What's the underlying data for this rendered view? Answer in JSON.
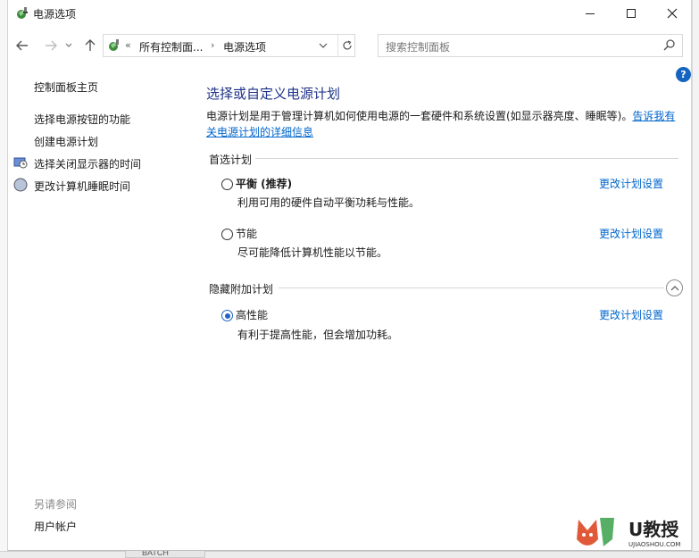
{
  "window": {
    "title": "电源选项"
  },
  "address": {
    "root": "所有控制面...",
    "current": "电源选项",
    "prefix": "«",
    "arrow": "›"
  },
  "search": {
    "placeholder": "搜索控制面板"
  },
  "help": {
    "label": "?"
  },
  "sidebar": {
    "home": "控制面板主页",
    "items": [
      {
        "label": "选择电源按钮的功能"
      },
      {
        "label": "创建电源计划"
      },
      {
        "label": "选择关闭显示器的时间"
      },
      {
        "label": "更改计算机睡眠时间"
      }
    ],
    "see_also_title": "另请参阅",
    "see_also_items": [
      {
        "label": "用户帐户"
      }
    ]
  },
  "main": {
    "title": "选择或自定义电源计划",
    "description_line1": "电源计划是用于管理计算机如何使用电源的一套硬件和系统设置(如显示器亮度、睡眠等)。",
    "description_link_part1": "告诉我有",
    "description_link_part2": "关电源计划的详细信息",
    "preferred_label": "首选计划",
    "hidden_label": "隐藏附加计划",
    "plans": [
      {
        "name": "平衡 (推荐)",
        "desc": "利用可用的硬件自动平衡功耗与性能。",
        "link": "更改计划设置",
        "selected": false
      },
      {
        "name": "节能",
        "desc": "尽可能降低计算机性能以节能。",
        "link": "更改计划设置",
        "selected": false
      },
      {
        "name": "高性能",
        "desc": "有利于提高性能，但会增加功耗。",
        "link": "更改计划设置",
        "selected": true
      }
    ]
  },
  "taskbar": {
    "item": "BATCH"
  },
  "watermark": {
    "brand": "U教授",
    "site": "UJIAOSHOU.COM"
  },
  "colors": {
    "accent": "#1e3287",
    "link": "#0066cc",
    "radio": "#1f63c4"
  }
}
